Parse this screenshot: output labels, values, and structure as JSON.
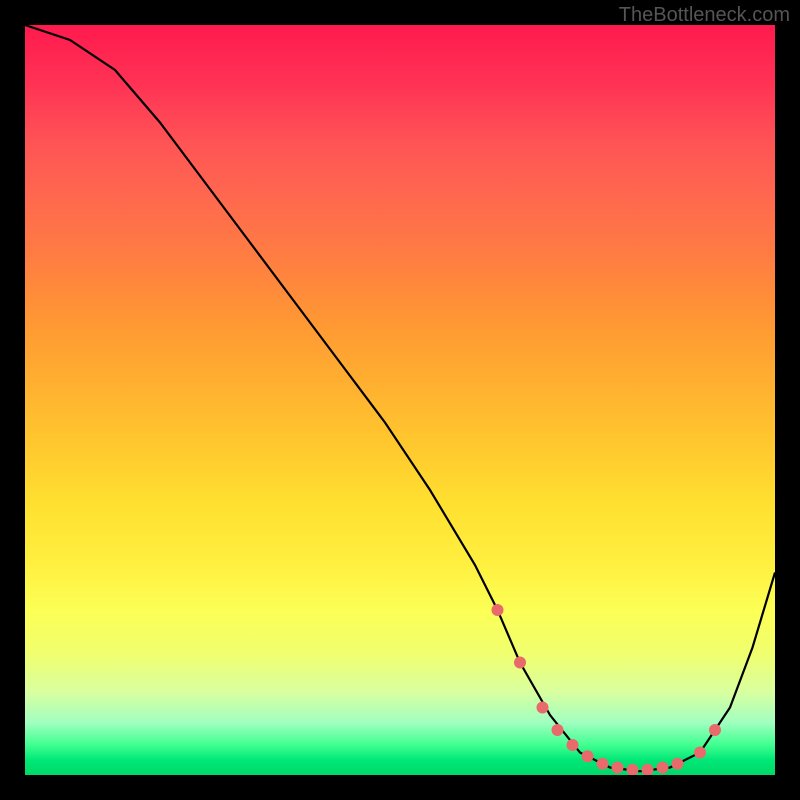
{
  "watermark": "TheBottleneck.com",
  "chart_data": {
    "type": "line",
    "title": "",
    "xlabel": "",
    "ylabel": "",
    "xlim": [
      0,
      100
    ],
    "ylim": [
      0,
      100
    ],
    "series": [
      {
        "name": "curve",
        "x": [
          0,
          6,
          12,
          18,
          24,
          30,
          36,
          42,
          48,
          54,
          60,
          63,
          66,
          70,
          74,
          78,
          82,
          86,
          90,
          94,
          97,
          100
        ],
        "values": [
          100,
          98,
          94,
          87,
          79,
          71,
          63,
          55,
          47,
          38,
          28,
          22,
          15,
          8,
          3,
          1,
          0.5,
          1,
          3,
          9,
          17,
          27
        ]
      }
    ],
    "markers": {
      "x": [
        63,
        66,
        69,
        71,
        73,
        75,
        77,
        79,
        81,
        83,
        85,
        87,
        90,
        92
      ],
      "values": [
        22,
        15,
        9,
        6,
        4,
        2.5,
        1.5,
        1,
        0.7,
        0.7,
        1,
        1.5,
        3,
        6
      ]
    },
    "gradient_stops": [
      {
        "pos": 0,
        "color": "#ff1a4d"
      },
      {
        "pos": 50,
        "color": "#ffc82e"
      },
      {
        "pos": 80,
        "color": "#fcff55"
      },
      {
        "pos": 100,
        "color": "#00d868"
      }
    ]
  }
}
